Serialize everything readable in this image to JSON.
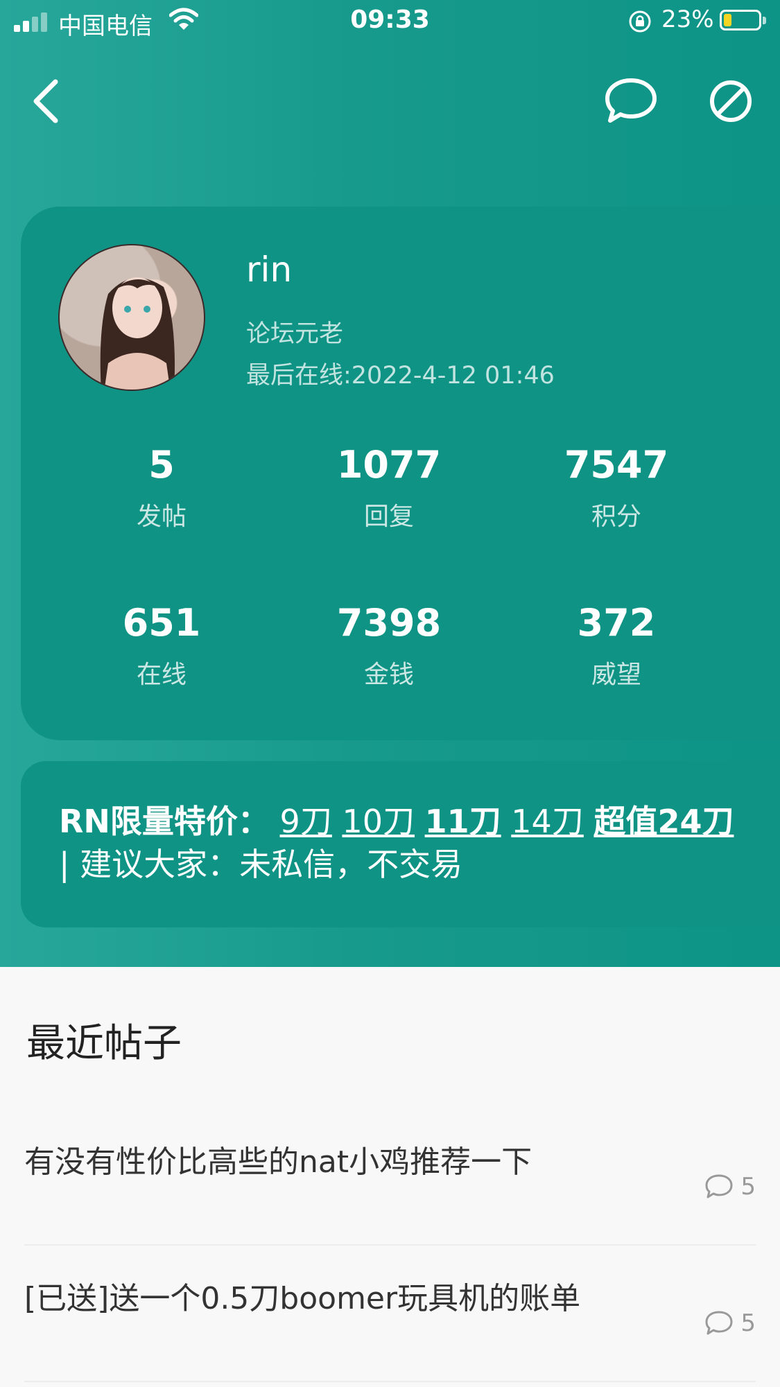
{
  "status_bar": {
    "carrier": "中国电信",
    "time": "09:33",
    "battery_percent": "23%",
    "battery_level": 0.23,
    "icons": [
      "signal-icon",
      "wifi-icon",
      "rotation-lock-icon",
      "battery-icon"
    ]
  },
  "nav": {
    "icons": [
      "back-icon",
      "message-icon",
      "block-icon"
    ]
  },
  "profile": {
    "username": "rin",
    "role": "论坛元老",
    "last_online": "最后在线:2022-4-12 01:46",
    "stats": [
      {
        "value": "5",
        "label": "发帖"
      },
      {
        "value": "1077",
        "label": "回复"
      },
      {
        "value": "7547",
        "label": "积分"
      },
      {
        "value": "651",
        "label": "在线"
      },
      {
        "value": "7398",
        "label": "金钱"
      },
      {
        "value": "372",
        "label": "威望"
      }
    ]
  },
  "ad": {
    "prefix": "RN限量特价：",
    "links": [
      "9刀",
      "10刀",
      "11刀",
      "14刀",
      "超值24刀"
    ],
    "suffix": " | 建议大家：未私信，不交易"
  },
  "recent_posts": {
    "title": "最近帖子",
    "items": [
      {
        "title": "有没有性价比高些的nat小鸡推荐一下",
        "comments": "5"
      },
      {
        "title": "[已送]送一个0.5刀boomer玩具机的账单",
        "comments": "5"
      }
    ]
  },
  "colors": {
    "header_bg": "#179a8c",
    "card_bg": "#0f9385",
    "battery_fill": "#f5d523"
  }
}
